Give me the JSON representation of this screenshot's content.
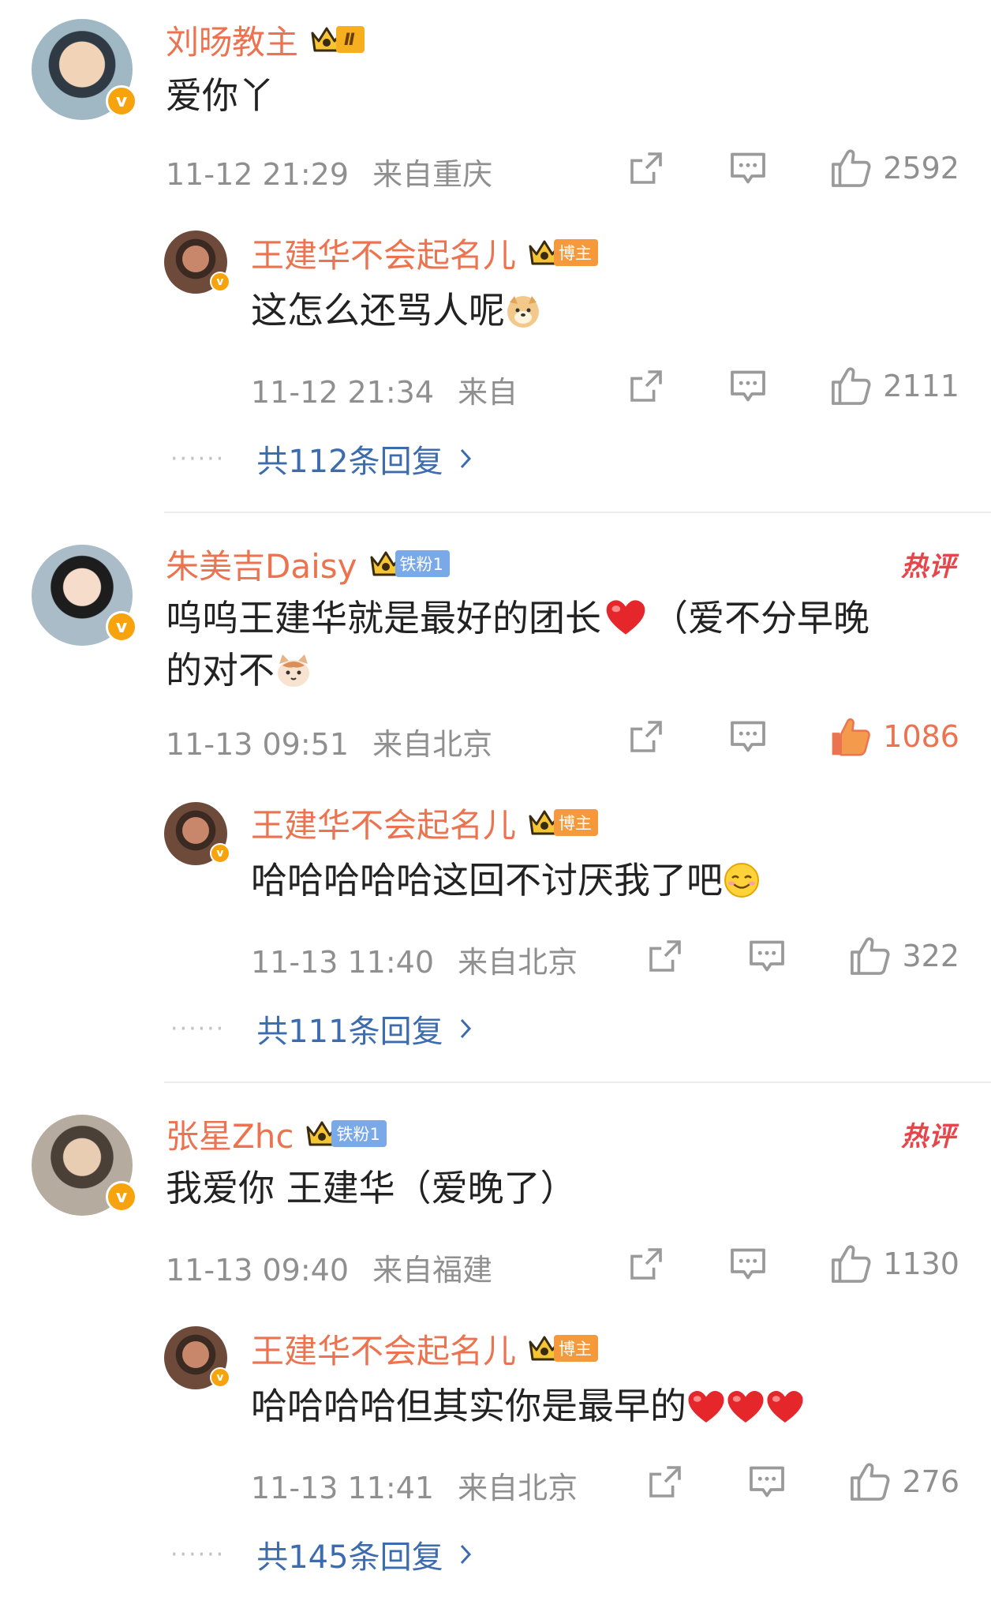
{
  "threads": [
    {
      "comment": {
        "username": "刘旸教主",
        "level_badge": "Ⅱ",
        "text": "爱你丫",
        "time": "11-12 21:29",
        "location": "来自重庆",
        "likes": "2592",
        "liked": false
      },
      "reply": {
        "username": "王建华不会起名儿",
        "badge": "博主",
        "text": "这怎么还骂人呢",
        "time": "11-12 21:34",
        "location": "来自",
        "likes": "2111"
      },
      "more_replies": "共112条回复"
    },
    {
      "comment": {
        "username": "朱美吉Daisy",
        "badge": "铁粉1",
        "hot": "热评",
        "text_line1": "呜呜王建华就是最好的团长",
        "text_line1b": "（爱不分早晚",
        "text_line2": "的对不",
        "time": "11-13 09:51",
        "location": "来自北京",
        "likes": "1086",
        "liked": true
      },
      "reply": {
        "username": "王建华不会起名儿",
        "badge": "博主",
        "text": "哈哈哈哈哈这回不讨厌我了吧",
        "time": "11-13 11:40",
        "location": "来自北京",
        "likes": "322"
      },
      "more_replies": "共111条回复"
    },
    {
      "comment": {
        "username": "张星Zhc",
        "badge": "铁粉1",
        "hot": "热评",
        "text": "我爱你 王建华（爱晚了）",
        "time": "11-13 09:40",
        "location": "来自福建",
        "likes": "1130",
        "liked": false
      },
      "reply": {
        "username": "王建华不会起名儿",
        "badge": "博主",
        "text": "哈哈哈哈但其实你是最早的",
        "time": "11-13 11:41",
        "location": "来自北京",
        "likes": "276"
      },
      "more_replies": "共145条回复"
    }
  ],
  "icons": [
    "verified-v-icon",
    "crown-icon",
    "repost-icon",
    "comment-icon",
    "like-icon",
    "chevron-right-icon",
    "heart-emoji",
    "doge-emoji",
    "cat-emoji",
    "smile-emoji"
  ],
  "colors": {
    "username": "#eb7350",
    "link": "#3d6cae",
    "meta": "#8f8f8f",
    "hot": "#e8444a",
    "verified": "#f7a30d"
  }
}
